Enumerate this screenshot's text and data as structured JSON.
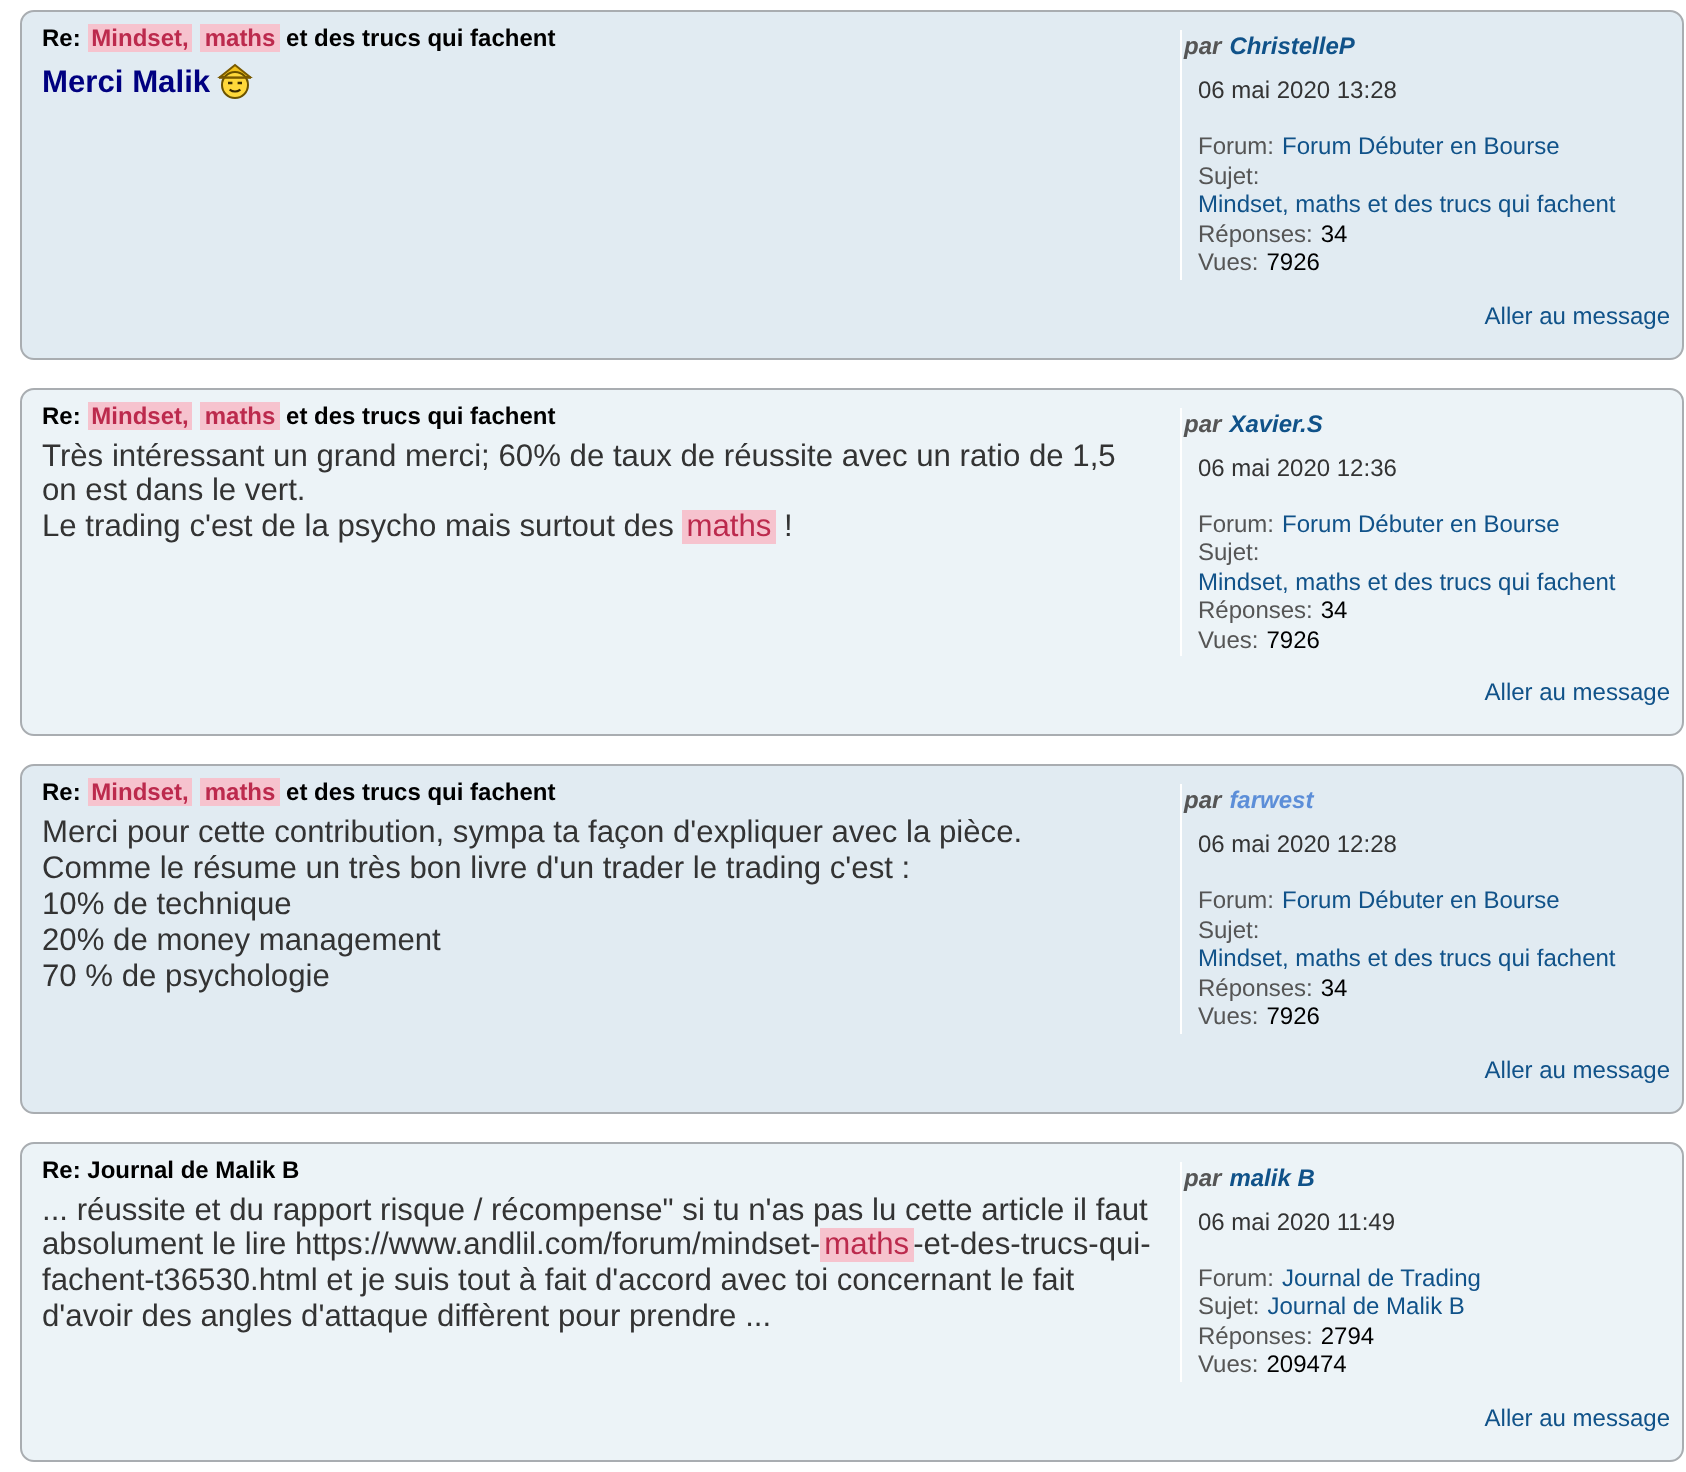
{
  "results": [
    {
      "title": [
        {
          "kind": "text",
          "text": "Re: "
        },
        {
          "kind": "highlight",
          "text": "Mindset,"
        },
        {
          "kind": "highlight",
          "text": "maths"
        },
        {
          "kind": "text",
          "text": " et des trucs qui fachent"
        }
      ],
      "body": [
        [
          {
            "kind": "strong",
            "text": "Merci Malik"
          },
          {
            "kind": "smiley"
          }
        ]
      ],
      "author": {
        "prefix": "par",
        "name": "ChristelleP",
        "color": "#105289"
      },
      "date": "06 mai 2020 13:28",
      "forum": {
        "label": "Forum:",
        "value": "Forum Débuter en Bourse"
      },
      "topic": {
        "label": "Sujet:",
        "value": "Mindset, maths et des trucs qui fachent"
      },
      "replies": {
        "label": "Réponses:",
        "value": "34"
      },
      "views": {
        "label": "Vues:",
        "value": "7926"
      },
      "jump_link": "Aller au message"
    },
    {
      "title": [
        {
          "kind": "text",
          "text": "Re: "
        },
        {
          "kind": "highlight",
          "text": "Mindset,"
        },
        {
          "kind": "highlight",
          "text": "maths"
        },
        {
          "kind": "text",
          "text": " et des trucs qui fachent"
        }
      ],
      "body": [
        [
          {
            "kind": "text",
            "text": "Très intéressant un grand merci; 60% de taux de réussite avec un ratio de 1,5"
          }
        ],
        [
          {
            "kind": "text",
            "text": "on est dans le vert."
          }
        ],
        [
          {
            "kind": "text",
            "text": "Le trading c'est de la psycho mais surtout des "
          },
          {
            "kind": "highlight",
            "text": "maths"
          },
          {
            "kind": "text",
            "text": " !"
          }
        ]
      ],
      "author": {
        "prefix": "par",
        "name": "Xavier.S",
        "color": "#105289"
      },
      "date": "06 mai 2020 12:36",
      "forum": {
        "label": "Forum:",
        "value": "Forum Débuter en Bourse"
      },
      "topic": {
        "label": "Sujet:",
        "value": "Mindset, maths et des trucs qui fachent"
      },
      "replies": {
        "label": "Réponses:",
        "value": "34"
      },
      "views": {
        "label": "Vues:",
        "value": "7926"
      },
      "jump_link": "Aller au message"
    },
    {
      "title": [
        {
          "kind": "text",
          "text": "Re: "
        },
        {
          "kind": "highlight",
          "text": "Mindset,"
        },
        {
          "kind": "highlight",
          "text": "maths"
        },
        {
          "kind": "text",
          "text": " et des trucs qui fachent"
        }
      ],
      "body": [
        [
          {
            "kind": "text",
            "text": "Merci pour cette contribution, sympa ta façon d'expliquer avec la pièce."
          }
        ],
        [
          {
            "kind": "text",
            "text": "Comme le résume un très bon livre d'un trader le trading c'est :"
          }
        ],
        [
          {
            "kind": "text",
            "text": "10% de technique"
          }
        ],
        [
          {
            "kind": "text",
            "text": "20% de money management"
          }
        ],
        [
          {
            "kind": "text",
            "text": "70 % de psychologie"
          }
        ]
      ],
      "author": {
        "prefix": "par",
        "name": "farwest",
        "color": "#5c8ed8"
      },
      "date": "06 mai 2020 12:28",
      "forum": {
        "label": "Forum:",
        "value": "Forum Débuter en Bourse"
      },
      "topic": {
        "label": "Sujet:",
        "value": "Mindset, maths et des trucs qui fachent"
      },
      "replies": {
        "label": "Réponses:",
        "value": "34"
      },
      "views": {
        "label": "Vues:",
        "value": "7926"
      },
      "jump_link": "Aller au message"
    },
    {
      "title": [
        {
          "kind": "text",
          "text": "Re: Journal de Malik B"
        }
      ],
      "body": [
        [
          {
            "kind": "text",
            "text": "... réussite et du rapport risque / récompense\" si tu n'as pas lu cette article il faut absolument le lire https://www.andlil.com/forum/mindset-"
          },
          {
            "kind": "highlight",
            "text": "maths"
          },
          {
            "kind": "text",
            "text": "-et-des-trucs-qui-fachent-t36530.html et je suis tout à fait d'accord avec toi concernant le fait d'avoir des angles d'attaque diffèrent pour prendre ..."
          }
        ]
      ],
      "author": {
        "prefix": "par",
        "name": "malik B",
        "color": "#105289"
      },
      "date": "06 mai 2020 11:49",
      "forum": {
        "label": "Forum:",
        "value": "Journal de Trading"
      },
      "topic": {
        "label": "Sujet:",
        "value": "Journal de Malik B"
      },
      "replies": {
        "label": "Réponses:",
        "value": "2794"
      },
      "views": {
        "label": "Vues:",
        "value": "209474"
      },
      "jump_link": "Aller au message"
    }
  ]
}
